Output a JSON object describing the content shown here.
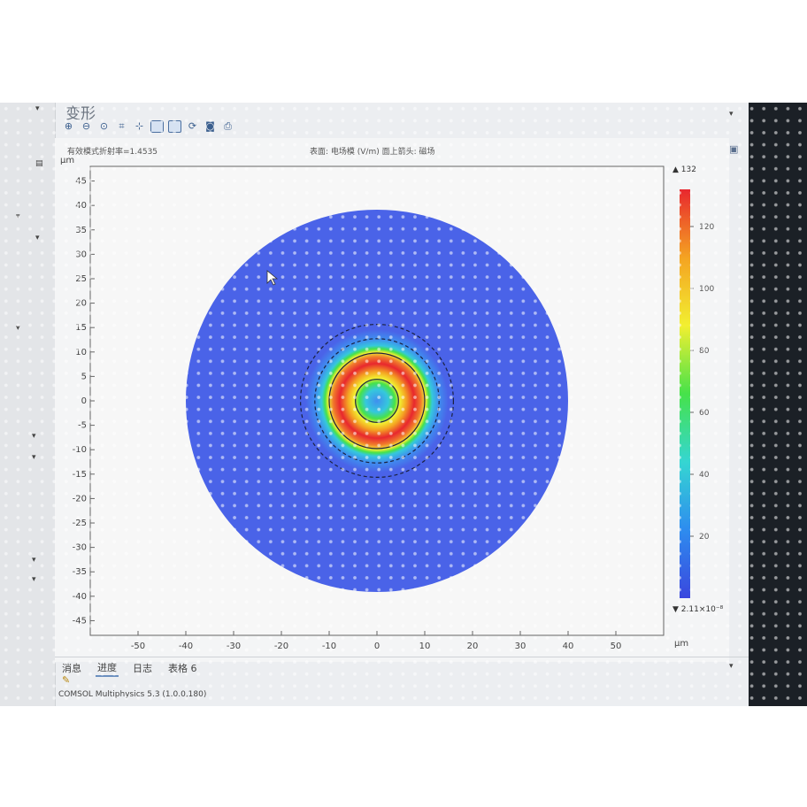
{
  "window": {
    "title": "变形",
    "status_tabs": [
      {
        "label": "消息",
        "active": false
      },
      {
        "label": "进度",
        "active": true
      },
      {
        "label": "日志",
        "active": false
      },
      {
        "label": "表格 6",
        "active": false
      }
    ]
  },
  "toolbar": {
    "icons": [
      "zoom-in-icon",
      "zoom-out-icon",
      "zoom-box-icon",
      "zoom-extents-icon",
      "axis-icon",
      "grid-icon",
      "layout-icon",
      "rotate-icon",
      "camera-icon",
      "print-icon"
    ]
  },
  "plot": {
    "caption_left": "有效模式折射率=1.4535",
    "caption_center": "表面: 电场模 (V/m)  面上箭头: 磁场",
    "xunit": "μm",
    "yunit": "μm",
    "xticks": [
      -50,
      -40,
      -30,
      -20,
      -10,
      0,
      10,
      20,
      30,
      40,
      50
    ],
    "yticks": [
      45,
      40,
      35,
      30,
      25,
      20,
      15,
      10,
      5,
      0,
      -5,
      -10,
      -15,
      -20,
      -25,
      -30,
      -35,
      -40,
      -45
    ]
  },
  "chart_data": {
    "type": "heatmap",
    "title": "表面: 电场模 (V/m)  面上箭头: 磁场",
    "xlabel": "μm",
    "ylabel": "μm",
    "xlim": [
      -60,
      60
    ],
    "ylim": [
      -48,
      48
    ],
    "domain_radius": 40,
    "field_peak_radius": 7.8,
    "boundaries": [
      {
        "radius": 4.5,
        "style": "solid"
      },
      {
        "radius": 10,
        "style": "solid"
      },
      {
        "radius": 13,
        "style": "dashed"
      },
      {
        "radius": 16,
        "style": "dashed"
      }
    ],
    "colorbar": {
      "max_label": "132",
      "min_label": "2.11×10⁻⁸",
      "ticks": [
        120,
        100,
        80,
        60,
        40,
        20
      ],
      "range": [
        0,
        132
      ],
      "colors": [
        "#3a47de",
        "#2e8cef",
        "#35d6d2",
        "#46e24a",
        "#f2ef31",
        "#f4a322",
        "#e8272e"
      ]
    },
    "colors": {
      "background_field": "#4a63e8"
    }
  },
  "statusline": "COMSOL Multiphysics 5.3 (1.0.0,180)"
}
